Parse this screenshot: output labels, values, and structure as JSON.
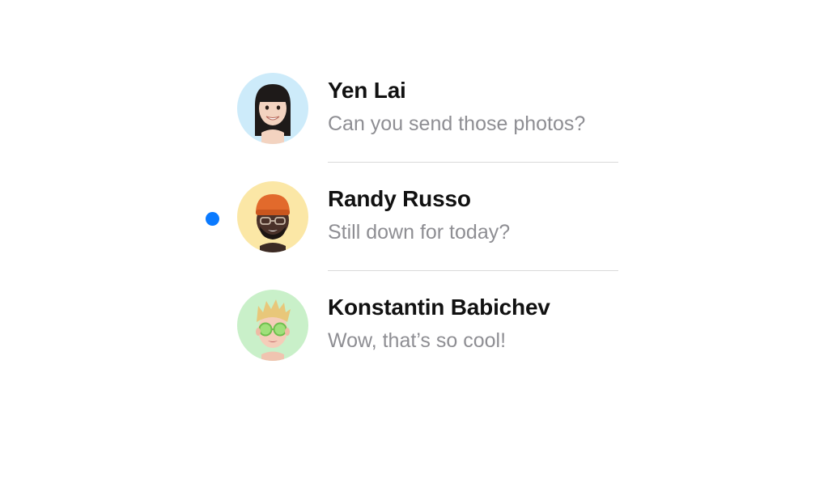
{
  "colors": {
    "unread_dot": "#0a7aff",
    "name_text": "#111111",
    "preview_text": "#8e8e93",
    "divider": "#dadada"
  },
  "conversations": [
    {
      "name": "Yen Lai",
      "preview": "Can you send those photos?",
      "unread": false,
      "avatar_icon": "memoji-woman-black-hair-icon",
      "avatar_bg": "#cdebfa"
    },
    {
      "name": "Randy Russo",
      "preview": "Still down for today?",
      "unread": true,
      "avatar_icon": "memoji-man-orange-beanie-icon",
      "avatar_bg": "#fbe7a6"
    },
    {
      "name": "Konstantin Babichev",
      "preview": "Wow, that’s so cool!",
      "unread": false,
      "avatar_icon": "memoji-man-green-sunglasses-icon",
      "avatar_bg": "#c9f0c9"
    }
  ]
}
